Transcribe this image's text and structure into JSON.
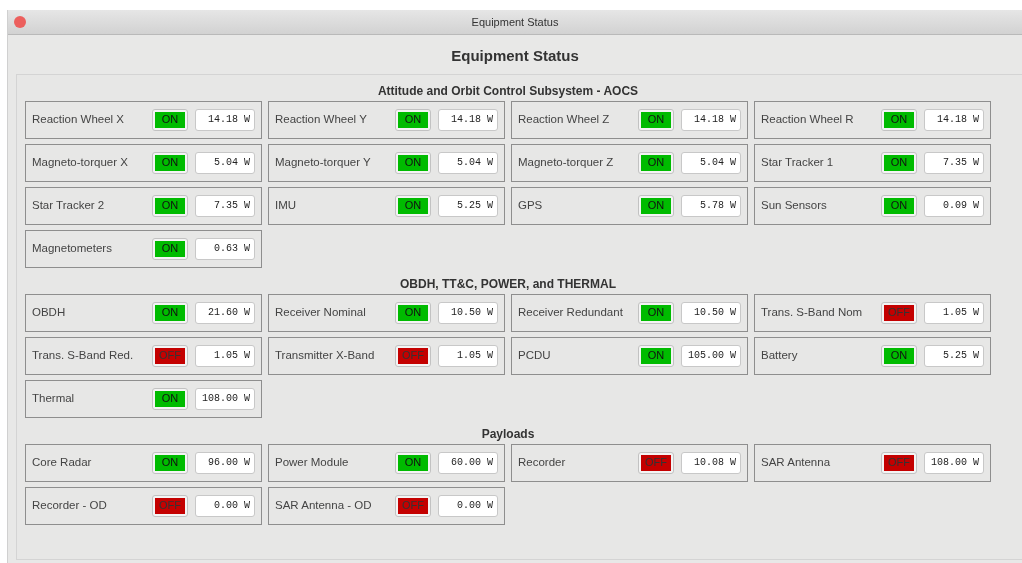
{
  "window": {
    "title": "Equipment Status",
    "close_button": true
  },
  "heading": "Equipment Status",
  "groups": [
    {
      "title": "Attitude and Orbit Control Subsystem - AOCS",
      "items": [
        {
          "name": "Reaction Wheel X",
          "on": true,
          "status": "ON",
          "power": "14.18 W"
        },
        {
          "name": "Reaction Wheel Y",
          "on": true,
          "status": "ON",
          "power": "14.18 W"
        },
        {
          "name": "Reaction Wheel Z",
          "on": true,
          "status": "ON",
          "power": "14.18 W"
        },
        {
          "name": "Reaction Wheel R",
          "on": true,
          "status": "ON",
          "power": "14.18 W"
        },
        {
          "name": "Magneto-torquer X",
          "on": true,
          "status": "ON",
          "power": "5.04 W"
        },
        {
          "name": "Magneto-torquer Y",
          "on": true,
          "status": "ON",
          "power": "5.04 W"
        },
        {
          "name": "Magneto-torquer Z",
          "on": true,
          "status": "ON",
          "power": "5.04 W"
        },
        {
          "name": "Star Tracker 1",
          "on": true,
          "status": "ON",
          "power": "7.35 W"
        },
        {
          "name": "Star Tracker 2",
          "on": true,
          "status": "ON",
          "power": "7.35 W"
        },
        {
          "name": "IMU",
          "on": true,
          "status": "ON",
          "power": "5.25 W"
        },
        {
          "name": "GPS",
          "on": true,
          "status": "ON",
          "power": "5.78 W"
        },
        {
          "name": "Sun Sensors",
          "on": true,
          "status": "ON",
          "power": "0.09 W"
        },
        {
          "name": "Magnetometers",
          "on": true,
          "status": "ON",
          "power": "0.63 W"
        }
      ]
    },
    {
      "title": "OBDH, TT&C, POWER, and THERMAL",
      "items": [
        {
          "name": "OBDH",
          "on": true,
          "status": "ON",
          "power": "21.60 W"
        },
        {
          "name": "Receiver Nominal",
          "on": true,
          "status": "ON",
          "power": "10.50 W"
        },
        {
          "name": "Receiver Redundant",
          "on": true,
          "status": "ON",
          "power": "10.50 W"
        },
        {
          "name": "Trans. S-Band Nom",
          "on": false,
          "status": "OFF",
          "power": "1.05 W"
        },
        {
          "name": "Trans. S-Band Red.",
          "on": false,
          "status": "OFF",
          "power": "1.05 W"
        },
        {
          "name": "Transmitter X-Band",
          "on": false,
          "status": "OFF",
          "power": "1.05 W"
        },
        {
          "name": "PCDU",
          "on": true,
          "status": "ON",
          "power": "105.00 W"
        },
        {
          "name": "Battery",
          "on": true,
          "status": "ON",
          "power": "5.25 W"
        },
        {
          "name": "Thermal",
          "on": true,
          "status": "ON",
          "power": "108.00 W"
        }
      ]
    },
    {
      "title": "Payloads",
      "items": [
        {
          "name": "Core Radar",
          "on": true,
          "status": "ON",
          "power": "96.00 W"
        },
        {
          "name": "Power Module",
          "on": true,
          "status": "ON",
          "power": "60.00 W"
        },
        {
          "name": "Recorder",
          "on": false,
          "status": "OFF",
          "power": "10.08 W"
        },
        {
          "name": "SAR Antenna",
          "on": false,
          "status": "OFF",
          "power": "108.00 W"
        },
        {
          "name": "Recorder - OD",
          "on": false,
          "status": "OFF",
          "power": "0.00 W"
        },
        {
          "name": "SAR Antenna - OD",
          "on": false,
          "status": "OFF",
          "power": "0.00 W"
        }
      ]
    }
  ]
}
